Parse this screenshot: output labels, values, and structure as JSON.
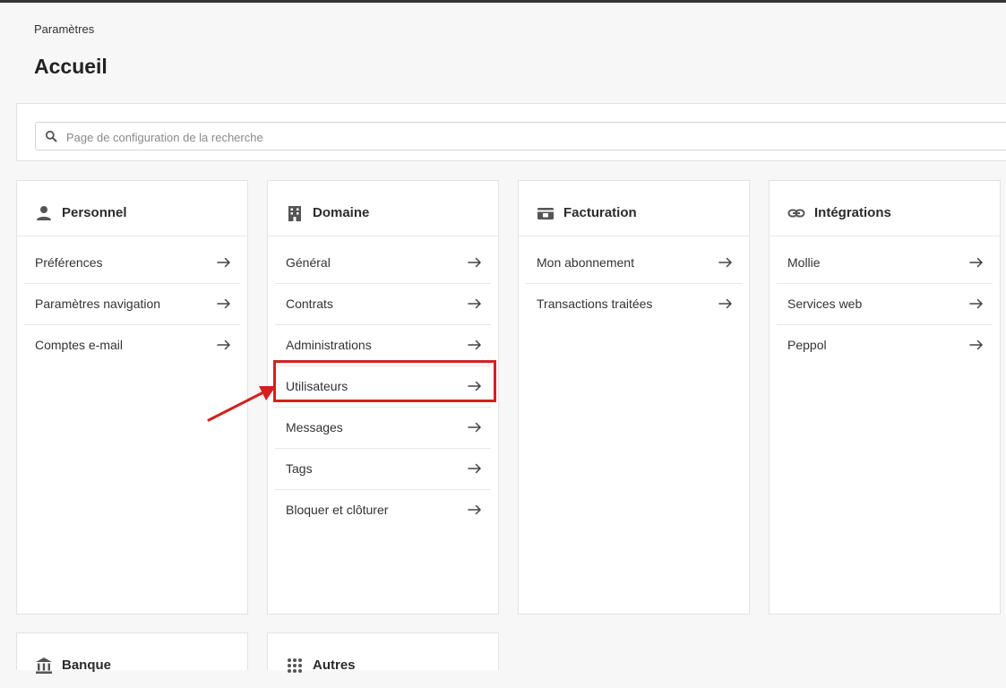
{
  "breadcrumb": "Paramètres",
  "page_title": "Accueil",
  "search": {
    "placeholder": "Page de configuration de la recherche"
  },
  "cards": {
    "personnel": {
      "title": "Personnel",
      "icon": "user-icon",
      "items": [
        "Préférences",
        "Paramètres navigation",
        "Comptes e-mail"
      ]
    },
    "domaine": {
      "title": "Domaine",
      "icon": "building-icon",
      "items": [
        "Général",
        "Contrats",
        "Administrations",
        "Utilisateurs",
        "Messages",
        "Tags",
        "Bloquer et clôturer"
      ]
    },
    "facturation": {
      "title": "Facturation",
      "icon": "billing-icon",
      "items": [
        "Mon abonnement",
        "Transactions traitées"
      ]
    },
    "integrations": {
      "title": "Intégrations",
      "icon": "link-icon",
      "items": [
        "Mollie",
        "Services web",
        "Peppol"
      ]
    },
    "banque": {
      "title": "Banque",
      "icon": "bank-icon"
    },
    "autres": {
      "title": "Autres",
      "icon": "grid-icon"
    }
  },
  "annotation": {
    "highlight_color": "#d42020",
    "highlighted_item": "Utilisateurs"
  },
  "colors": {
    "top_bar": "#333333",
    "background": "#f7f7f7",
    "card": "#ffffff"
  }
}
